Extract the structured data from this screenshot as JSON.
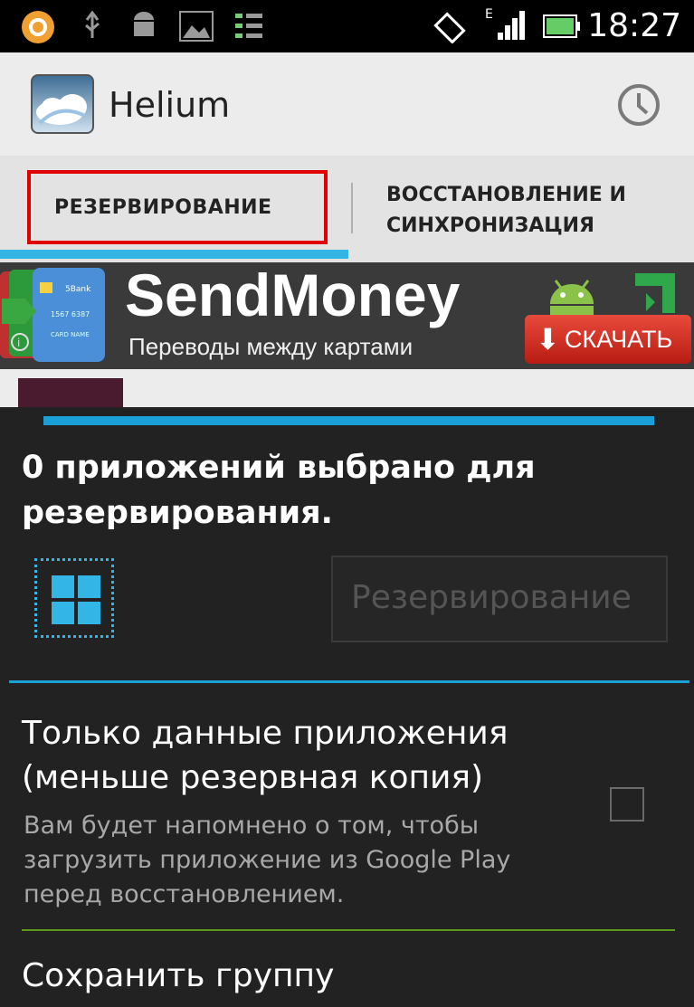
{
  "status_bar": {
    "time": "18:27",
    "icons": [
      "aimp-icon",
      "usb-icon",
      "android-debug-icon",
      "image-icon",
      "tasks-icon",
      "rotate-icon",
      "signal-icon",
      "battery-icon"
    ],
    "network_type": "E"
  },
  "action_bar": {
    "app_title": "Helium",
    "history_icon": "clock-icon"
  },
  "tabs": [
    {
      "label": "РЕЗЕРВИРОВАНИЕ",
      "selected": true
    },
    {
      "label": "ВОССТАНОВЛЕНИЕ И СИНХРОНИЗАЦИЯ",
      "selected": false
    }
  ],
  "ad": {
    "title": "SendMoney",
    "subtitle": "Переводы между картами",
    "button_label": "СКАЧАТЬ"
  },
  "main": {
    "selected_count_text": "0 приложений выбрано для резервирования.",
    "backup_button_label": "Резервирование",
    "app_data_only": {
      "title": "Только данные приложения (меньше резервная копия)",
      "description": "Вам будет напомнено о том, чтобы загрузить приложение из Google Play перед восстановлением.",
      "checked": false
    },
    "save_group_label": "Сохранить группу"
  },
  "colors": {
    "accent": "#33b5e5",
    "highlight_box": "#e00000",
    "background": "#222222"
  }
}
